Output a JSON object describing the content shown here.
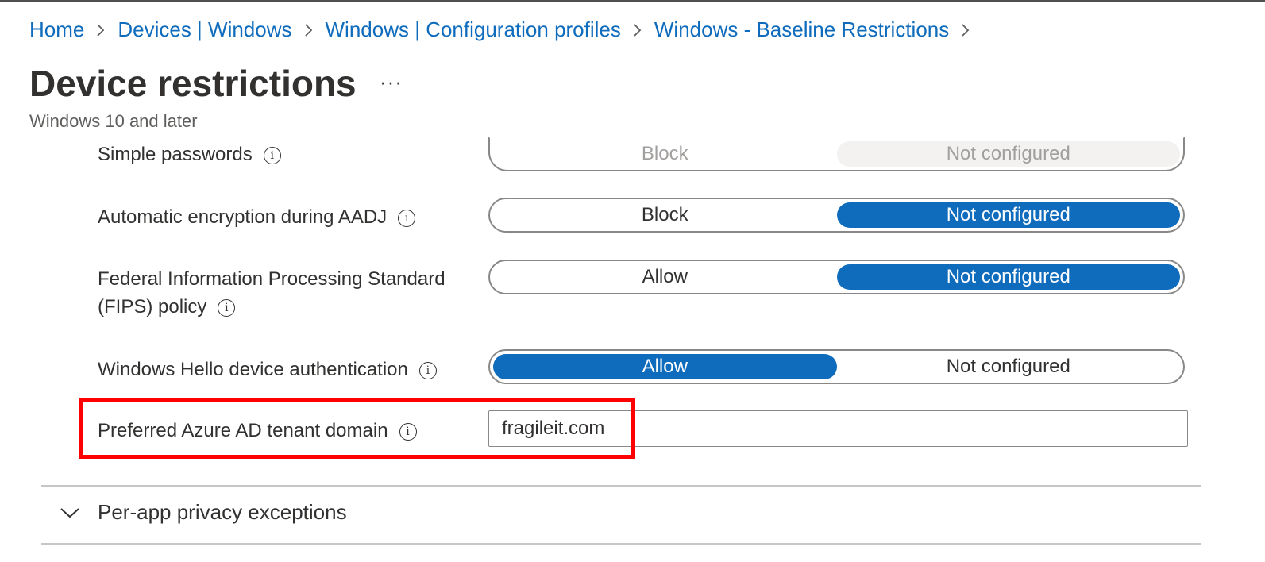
{
  "breadcrumb": [
    {
      "label": "Home"
    },
    {
      "label": "Devices | Windows"
    },
    {
      "label": "Windows | Configuration profiles"
    },
    {
      "label": "Windows - Baseline Restrictions"
    }
  ],
  "page": {
    "title": "Device restrictions",
    "more": "···",
    "subtitle": "Windows 10 and later"
  },
  "settings": [
    {
      "label": "Simple passwords",
      "options": [
        "Block",
        "Not configured"
      ],
      "selected": "Not configured",
      "disabled": true
    },
    {
      "label": "Automatic encryption during AADJ",
      "options": [
        "Block",
        "Not configured"
      ],
      "selected": "Not configured"
    },
    {
      "label_line1": "Federal Information Processing Standard",
      "label_line2": "(FIPS) policy",
      "options": [
        "Allow",
        "Not configured"
      ],
      "selected": "Not configured"
    },
    {
      "label": "Windows Hello device authentication",
      "options": [
        "Allow",
        "Not configured"
      ],
      "selected": "Allow"
    }
  ],
  "tenant": {
    "label": "Preferred Azure AD tenant domain",
    "value": "fragileit.com"
  },
  "section": {
    "label": "Per-app privacy exceptions"
  },
  "info_glyph": "i",
  "colors": {
    "accent": "#0f6cbd",
    "highlight": "#ff0000"
  }
}
